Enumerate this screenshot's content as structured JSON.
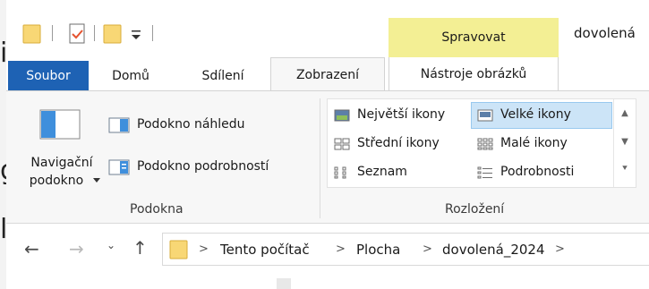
{
  "titlebar": {
    "contextual_group": "Spravovat",
    "window_title": "dovolená"
  },
  "tabs": {
    "file": "Soubor",
    "home": "Domů",
    "share": "Sdílení",
    "view": "Zobrazení",
    "picture_tools": "Nástroje obrázků"
  },
  "panes": {
    "nav_pane_line1": "Navigační",
    "nav_pane_line2": "podokno",
    "preview_pane": "Podokno náhledu",
    "details_pane": "Podokno podrobností",
    "group_label": "Podokna"
  },
  "layout": {
    "extra_large": "Největší ikony",
    "large": "Velké ikony",
    "medium": "Střední ikony",
    "small": "Malé ikony",
    "list": "Seznam",
    "details": "Podrobnosti",
    "group_label": "Rozložení",
    "selected": "Velké ikony"
  },
  "address": {
    "crumbs": [
      "Tento počítač",
      "Plocha",
      "dovolená_2024"
    ]
  },
  "colors": {
    "file_tab": "#1e62b4",
    "contextual": "#f3ef94",
    "selection": "#cce4f7"
  }
}
